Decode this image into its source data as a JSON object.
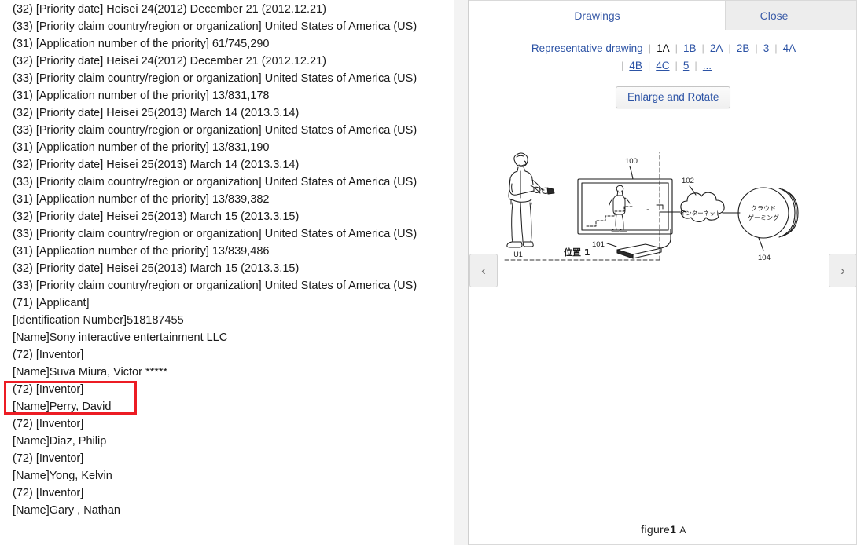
{
  "document": {
    "lines": [
      "(32) [Priority date] Heisei 24(2012) December 21 (2012.12.21)",
      "(33) [Priority claim country/region or organization] United States of America (US)",
      "(31) [Application number of the priority] 61/745,290",
      "(32) [Priority date] Heisei 24(2012) December 21 (2012.12.21)",
      "(33) [Priority claim country/region or organization] United States of America (US)",
      "(31) [Application number of the priority] 13/831,178",
      "(32) [Priority date] Heisei 25(2013) March 14 (2013.3.14)",
      "(33) [Priority claim country/region or organization] United States of America (US)",
      "(31) [Application number of the priority] 13/831,190",
      "(32) [Priority date] Heisei 25(2013) March 14 (2013.3.14)",
      "(33) [Priority claim country/region or organization] United States of America (US)",
      "(31) [Application number of the priority] 13/839,382",
      "(32) [Priority date] Heisei 25(2013) March 15 (2013.3.15)",
      "(33) [Priority claim country/region or organization] United States of America (US)",
      "(31) [Application number of the priority] 13/839,486",
      "(32) [Priority date] Heisei 25(2013) March 15 (2013.3.15)",
      "(33) [Priority claim country/region or organization] United States of America (US)",
      "(71) [Applicant]",
      "[Identification Number]518187455",
      "[Name]Sony interactive entertainment LLC",
      "(72) [Inventor]",
      "[Name]Suva Miura, Victor *****",
      "(72) [Inventor]",
      "[Name]Perry, David",
      "(72) [Inventor]",
      "[Name]Diaz, Philip",
      "(72) [Inventor]",
      "[Name]Yong, Kelvin",
      "(72) [Inventor]",
      "[Name]Gary , Nathan"
    ],
    "highlight": {
      "color": "#ec1c24",
      "first_line_index": 20,
      "last_line_index": 21
    }
  },
  "drawings_panel": {
    "title": "Drawings",
    "close_label": "Close",
    "minimize_label": "—",
    "enlarge_button": "Enlarge and Rotate",
    "prev_arrow": "‹",
    "next_arrow": "›",
    "tabs_row1": [
      {
        "label": "Representative drawing",
        "active": false
      },
      {
        "label": "1A",
        "active": true
      },
      {
        "label": "1B",
        "active": false
      },
      {
        "label": "2A",
        "active": false
      },
      {
        "label": "2B",
        "active": false
      },
      {
        "label": "3",
        "active": false
      },
      {
        "label": "4A",
        "active": false
      }
    ],
    "tabs_row2": [
      {
        "label": "4B",
        "active": false
      },
      {
        "label": "4C",
        "active": false
      },
      {
        "label": "5",
        "active": false
      },
      {
        "label": "...",
        "active": false
      }
    ],
    "figure_caption_prefix": "figure",
    "figure_caption_number": "1",
    "figure_caption_suffix": "A",
    "figure_labels": {
      "user": "U1",
      "position": "位置 1",
      "tv_ref": "100",
      "console_ref": "101",
      "internet_ref": "102",
      "cloud_ref": "104",
      "internet_text_line1": "インターネット",
      "cloud_text_line1": "クラウド",
      "cloud_text_line2": "ゲーミング"
    }
  }
}
